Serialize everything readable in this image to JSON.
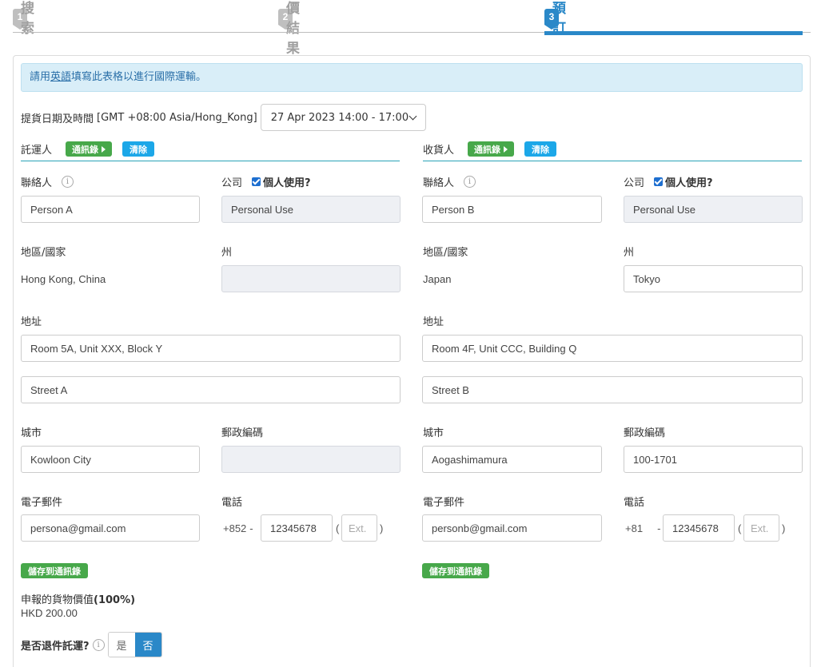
{
  "steps": [
    {
      "num": "1",
      "label": "搜索"
    },
    {
      "num": "2",
      "label": "報價結果"
    },
    {
      "num": "3",
      "label": "預訂"
    }
  ],
  "notice": {
    "prefix": "請用",
    "link": "英語",
    "suffix": "填寫此表格以進行國際運輸。"
  },
  "pickup": {
    "label": "提貨日期及時間",
    "timezone": "[GMT +08:00 Asia/Hong_Kong]",
    "value": "27 Apr 2023 14:00 - 17:00"
  },
  "buttons": {
    "address_book": "通訊錄",
    "clear": "清除",
    "save_to_book": "儲存到通訊錄"
  },
  "labels": {
    "contact": "聯絡人",
    "company": "公司",
    "personal_use": "個人使用?",
    "region": "地區/國家",
    "state": "州",
    "address": "地址",
    "city": "城市",
    "postal": "郵政編碼",
    "email": "電子郵件",
    "phone": "電話",
    "ext_placeholder": "Ext."
  },
  "shipper": {
    "title": "託運人",
    "contact": "Person A",
    "company": "Personal Use",
    "region": "Hong Kong, China",
    "state": "",
    "address1": "Room 5A, Unit XXX, Block Y",
    "address2": "Street A",
    "city": "Kowloon City",
    "postal": "",
    "email": "persona@gmail.com",
    "phone_code": "+852",
    "phone": "12345678"
  },
  "consignee": {
    "title": "收貨人",
    "contact": "Person B",
    "company": "Personal Use",
    "region": "Japan",
    "state": "Tokyo",
    "address1": "Room 4F, Unit CCC, Building Q",
    "address2": "Street B",
    "city": "Aogashimamura",
    "postal": "100-1701",
    "email": "personb@gmail.com",
    "phone_code": "+81",
    "phone": "12345678"
  },
  "declared": {
    "label": "申報的貨物價值",
    "pct": "(100%)",
    "value": "HKD 200.00"
  },
  "return_shipment": {
    "label": "是否退件託運?",
    "yes": "是",
    "no": "否",
    "selected": "no"
  },
  "colors": {
    "accent": "#2a88c8",
    "green": "#47a84a",
    "clear_blue": "#1ca7e8",
    "notice_bg": "#d9eef8"
  }
}
